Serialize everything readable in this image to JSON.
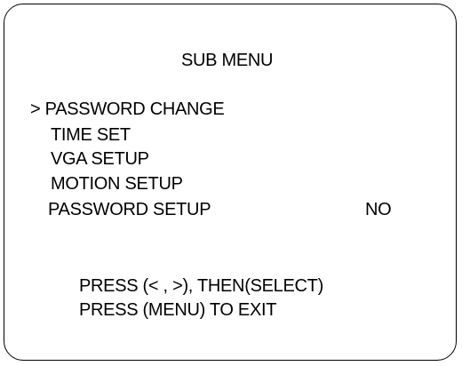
{
  "menu": {
    "title": "SUB MENU",
    "cursor": "> ",
    "items": [
      {
        "label": "PASSWORD CHANGE"
      },
      {
        "label": "TIME SET"
      },
      {
        "label": "VGA SETUP"
      },
      {
        "label": "MOTION SETUP"
      },
      {
        "label": "PASSWORD SETUP",
        "value": "NO"
      }
    ]
  },
  "hints": [
    "PRESS (< , >), THEN(SELECT)",
    "PRESS (MENU) TO EXIT"
  ],
  "colors": {
    "background": "#ffffff",
    "text": "#000000"
  }
}
